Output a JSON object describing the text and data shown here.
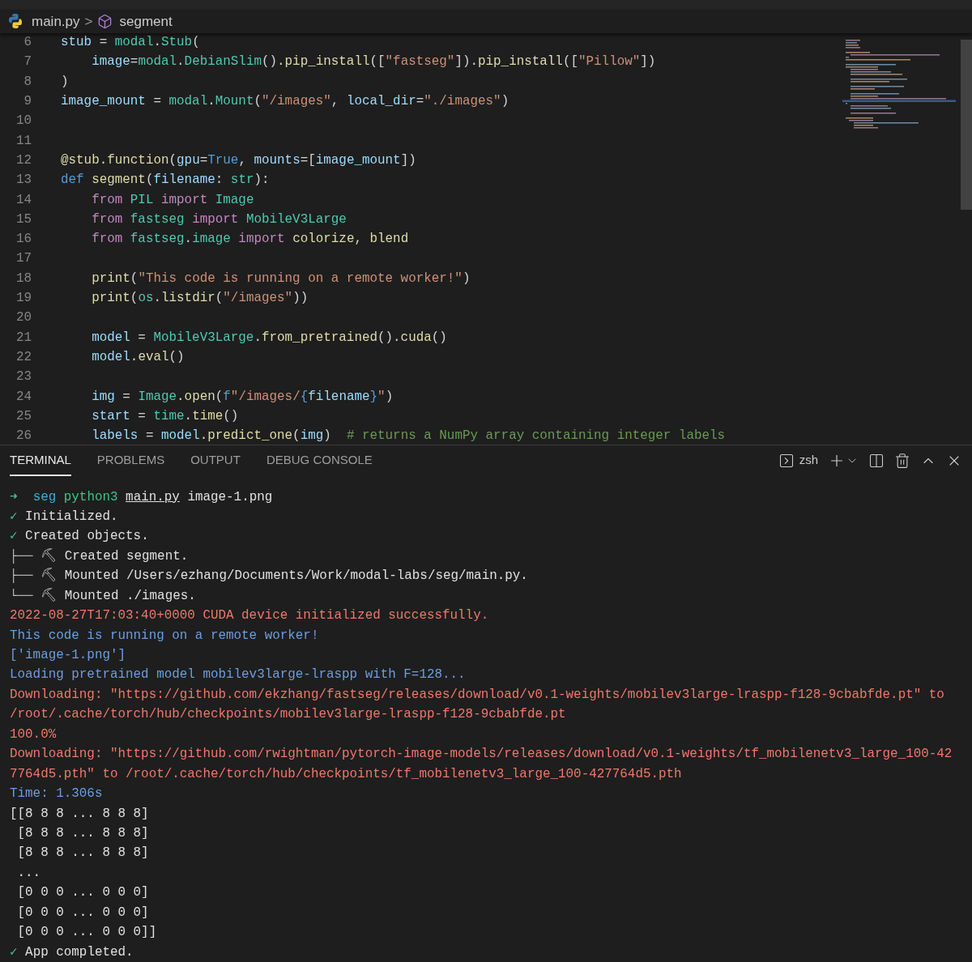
{
  "breadcrumb": {
    "file": "main.py",
    "separator": ">",
    "symbol": "segment"
  },
  "editor": {
    "lines": [
      {
        "number": "6",
        "tokens": [
          {
            "t": "stub",
            "kind": "var"
          },
          {
            "t": " = ",
            "kind": "plain"
          },
          {
            "t": "modal",
            "kind": "cls"
          },
          {
            "t": ".",
            "kind": "plain"
          },
          {
            "t": "Stub",
            "kind": "cls"
          },
          {
            "t": "(",
            "kind": "plain"
          }
        ]
      },
      {
        "number": "7",
        "tokens": [
          {
            "t": "    image",
            "kind": "var"
          },
          {
            "t": "=",
            "kind": "plain"
          },
          {
            "t": "modal",
            "kind": "cls"
          },
          {
            "t": ".",
            "kind": "plain"
          },
          {
            "t": "DebianSlim",
            "kind": "cls"
          },
          {
            "t": "().",
            "kind": "plain"
          },
          {
            "t": "pip_install",
            "kind": "func"
          },
          {
            "t": "([",
            "kind": "plain"
          },
          {
            "t": "\"fastseg\"",
            "kind": "str"
          },
          {
            "t": "]).",
            "kind": "plain"
          },
          {
            "t": "pip_install",
            "kind": "func"
          },
          {
            "t": "([",
            "kind": "plain"
          },
          {
            "t": "\"Pillow\"",
            "kind": "str"
          },
          {
            "t": "])",
            "kind": "plain"
          }
        ]
      },
      {
        "number": "8",
        "tokens": [
          {
            "t": ")",
            "kind": "plain"
          }
        ]
      },
      {
        "number": "9",
        "tokens": [
          {
            "t": "image_mount",
            "kind": "var"
          },
          {
            "t": " = ",
            "kind": "plain"
          },
          {
            "t": "modal",
            "kind": "cls"
          },
          {
            "t": ".",
            "kind": "plain"
          },
          {
            "t": "Mount",
            "kind": "cls"
          },
          {
            "t": "(",
            "kind": "plain"
          },
          {
            "t": "\"/images\"",
            "kind": "str"
          },
          {
            "t": ", ",
            "kind": "plain"
          },
          {
            "t": "local_dir",
            "kind": "var"
          },
          {
            "t": "=",
            "kind": "plain"
          },
          {
            "t": "\"./images\"",
            "kind": "str"
          },
          {
            "t": ")",
            "kind": "plain"
          }
        ]
      },
      {
        "number": "10"
      },
      {
        "number": "11"
      },
      {
        "number": "12",
        "tokens": [
          {
            "t": "@stub.function",
            "kind": "func"
          },
          {
            "t": "(",
            "kind": "plain"
          },
          {
            "t": "gpu",
            "kind": "var"
          },
          {
            "t": "=",
            "kind": "plain"
          },
          {
            "t": "True",
            "kind": "kw"
          },
          {
            "t": ", ",
            "kind": "plain"
          },
          {
            "t": "mounts",
            "kind": "var"
          },
          {
            "t": "=[",
            "kind": "plain"
          },
          {
            "t": "image_mount",
            "kind": "var"
          },
          {
            "t": "])",
            "kind": "plain"
          }
        ]
      },
      {
        "number": "13",
        "tokens": [
          {
            "t": "def ",
            "kind": "kw"
          },
          {
            "t": "segment",
            "kind": "func"
          },
          {
            "t": "(",
            "kind": "plain"
          },
          {
            "t": "filename",
            "kind": "var"
          },
          {
            "t": ": ",
            "kind": "plain"
          },
          {
            "t": "str",
            "kind": "cls"
          },
          {
            "t": "):",
            "kind": "plain"
          }
        ]
      },
      {
        "number": "14",
        "tokens": [
          {
            "t": "    from ",
            "kind": "ctrl"
          },
          {
            "t": "PIL ",
            "kind": "cls"
          },
          {
            "t": "import ",
            "kind": "ctrl"
          },
          {
            "t": "Image",
            "kind": "cls"
          }
        ]
      },
      {
        "number": "15",
        "tokens": [
          {
            "t": "    from ",
            "kind": "ctrl"
          },
          {
            "t": "fastseg ",
            "kind": "cls"
          },
          {
            "t": "import ",
            "kind": "ctrl"
          },
          {
            "t": "MobileV3Large",
            "kind": "cls"
          }
        ]
      },
      {
        "number": "16",
        "tokens": [
          {
            "t": "    from ",
            "kind": "ctrl"
          },
          {
            "t": "fastseg",
            "kind": "cls"
          },
          {
            "t": ".",
            "kind": "plain"
          },
          {
            "t": "image ",
            "kind": "cls"
          },
          {
            "t": "import ",
            "kind": "ctrl"
          },
          {
            "t": "colorize",
            "kind": "func"
          },
          {
            "t": ", ",
            "kind": "plain"
          },
          {
            "t": "blend",
            "kind": "func"
          }
        ]
      },
      {
        "number": "17"
      },
      {
        "number": "18",
        "tokens": [
          {
            "t": "    print",
            "kind": "func"
          },
          {
            "t": "(",
            "kind": "plain"
          },
          {
            "t": "\"This code is running on a remote worker!\"",
            "kind": "str"
          },
          {
            "t": ")",
            "kind": "plain"
          }
        ]
      },
      {
        "number": "19",
        "tokens": [
          {
            "t": "    print",
            "kind": "func"
          },
          {
            "t": "(",
            "kind": "plain"
          },
          {
            "t": "os",
            "kind": "cls"
          },
          {
            "t": ".",
            "kind": "plain"
          },
          {
            "t": "listdir",
            "kind": "func"
          },
          {
            "t": "(",
            "kind": "plain"
          },
          {
            "t": "\"/images\"",
            "kind": "str"
          },
          {
            "t": "))",
            "kind": "plain"
          }
        ]
      },
      {
        "number": "20"
      },
      {
        "number": "21",
        "tokens": [
          {
            "t": "    model",
            "kind": "var"
          },
          {
            "t": " = ",
            "kind": "plain"
          },
          {
            "t": "MobileV3Large",
            "kind": "cls"
          },
          {
            "t": ".",
            "kind": "plain"
          },
          {
            "t": "from_pretrained",
            "kind": "func"
          },
          {
            "t": "().",
            "kind": "plain"
          },
          {
            "t": "cuda",
            "kind": "func"
          },
          {
            "t": "()",
            "kind": "plain"
          }
        ]
      },
      {
        "number": "22",
        "tokens": [
          {
            "t": "    model",
            "kind": "var"
          },
          {
            "t": ".",
            "kind": "plain"
          },
          {
            "t": "eval",
            "kind": "func"
          },
          {
            "t": "()",
            "kind": "plain"
          }
        ]
      },
      {
        "number": "23"
      },
      {
        "number": "24",
        "tokens": [
          {
            "t": "    img",
            "kind": "var"
          },
          {
            "t": " = ",
            "kind": "plain"
          },
          {
            "t": "Image",
            "kind": "cls"
          },
          {
            "t": ".",
            "kind": "plain"
          },
          {
            "t": "open",
            "kind": "func"
          },
          {
            "t": "(",
            "kind": "plain"
          },
          {
            "t": "f",
            "kind": "kw"
          },
          {
            "t": "\"/images/",
            "kind": "str"
          },
          {
            "t": "{",
            "kind": "kw"
          },
          {
            "t": "filename",
            "kind": "var"
          },
          {
            "t": "}",
            "kind": "kw"
          },
          {
            "t": "\"",
            "kind": "str"
          },
          {
            "t": ")",
            "kind": "plain"
          }
        ]
      },
      {
        "number": "25",
        "tokens": [
          {
            "t": "    start",
            "kind": "var"
          },
          {
            "t": " = ",
            "kind": "plain"
          },
          {
            "t": "time",
            "kind": "cls"
          },
          {
            "t": ".",
            "kind": "plain"
          },
          {
            "t": "time",
            "kind": "func"
          },
          {
            "t": "()",
            "kind": "plain"
          }
        ]
      },
      {
        "number": "26",
        "tokens": [
          {
            "t": "    labels",
            "kind": "var"
          },
          {
            "t": " = ",
            "kind": "plain"
          },
          {
            "t": "model",
            "kind": "var"
          },
          {
            "t": ".",
            "kind": "plain"
          },
          {
            "t": "predict_one",
            "kind": "func"
          },
          {
            "t": "(",
            "kind": "plain"
          },
          {
            "t": "img",
            "kind": "var"
          },
          {
            "t": ")  ",
            "kind": "plain"
          },
          {
            "t": "# returns a NumPy array containing integer labels",
            "kind": "comment"
          }
        ]
      }
    ]
  },
  "panel": {
    "tabs": [
      {
        "label": "TERMINAL",
        "selected": true
      },
      {
        "label": "PROBLEMS",
        "selected": false
      },
      {
        "label": "OUTPUT",
        "selected": false
      },
      {
        "label": "DEBUG CONSOLE",
        "selected": false
      }
    ],
    "shell": "zsh",
    "lines": [
      [
        {
          "t": "➜  ",
          "kind": "green"
        },
        {
          "t": "seg ",
          "kind": "cyan"
        },
        {
          "t": "python3 ",
          "kind": "green"
        },
        {
          "t": "main.py",
          "kind": "underline"
        },
        {
          "t": " image-1.png",
          "kind": "plain"
        }
      ],
      [
        {
          "t": "✓ ",
          "kind": "green"
        },
        {
          "t": "Initialized.",
          "kind": "plain"
        }
      ],
      [
        {
          "t": "✓ ",
          "kind": "green"
        },
        {
          "t": "Created objects.",
          "kind": "plain"
        }
      ],
      [
        {
          "t": "├── ⛏ ",
          "kind": "dim"
        },
        {
          "t": "Created segment.",
          "kind": "plain"
        }
      ],
      [
        {
          "t": "├── ⛏ ",
          "kind": "dim"
        },
        {
          "t": "Mounted /Users/ezhang/Documents/Work/modal-labs/seg/main.py.",
          "kind": "plain"
        }
      ],
      [
        {
          "t": "└── ⛏ ",
          "kind": "dim"
        },
        {
          "t": "Mounted ./images.",
          "kind": "plain"
        }
      ],
      [
        {
          "t": "2022-08-27T17:03:40+0000 CUDA device initialized successfully.",
          "kind": "red"
        }
      ],
      [
        {
          "t": "This code is running on a remote worker!",
          "kind": "blue"
        }
      ],
      [
        {
          "t": "['image-1.png']",
          "kind": "blue"
        }
      ],
      [
        {
          "t": "Loading pretrained model mobilev3large-lraspp with F=128...",
          "kind": "blue"
        }
      ],
      [
        {
          "t": "Downloading: \"https://github.com/ekzhang/fastseg/releases/download/v0.1-weights/mobilev3large-lraspp-f128-9cbabfde.pt\" to",
          "kind": "red"
        }
      ],
      [
        {
          "t": "/root/.cache/torch/hub/checkpoints/mobilev3large-lraspp-f128-9cbabfde.pt",
          "kind": "red"
        }
      ],
      [
        {
          "t": "100.0%",
          "kind": "red"
        }
      ],
      [
        {
          "t": "Downloading: \"https://github.com/rwightman/pytorch-image-models/releases/download/v0.1-weights/tf_mobilenetv3_large_100-42",
          "kind": "red"
        }
      ],
      [
        {
          "t": "7764d5.pth\" to /root/.cache/torch/hub/checkpoints/tf_mobilenetv3_large_100-427764d5.pth",
          "kind": "red"
        }
      ],
      [
        {
          "t": "Time: 1.306s",
          "kind": "blue"
        }
      ],
      [
        {
          "t": "[[8 8 8 ... 8 8 8]",
          "kind": "plain"
        }
      ],
      [
        {
          "t": " [8 8 8 ... 8 8 8]",
          "kind": "plain"
        }
      ],
      [
        {
          "t": " [8 8 8 ... 8 8 8]",
          "kind": "plain"
        }
      ],
      [
        {
          "t": " ...",
          "kind": "plain"
        }
      ],
      [
        {
          "t": " [0 0 0 ... 0 0 0]",
          "kind": "plain"
        }
      ],
      [
        {
          "t": " [0 0 0 ... 0 0 0]",
          "kind": "plain"
        }
      ],
      [
        {
          "t": " [0 0 0 ... 0 0 0]]",
          "kind": "plain"
        }
      ],
      [
        {
          "t": "✓ ",
          "kind": "green"
        },
        {
          "t": "App completed.",
          "kind": "plain"
        }
      ]
    ]
  }
}
